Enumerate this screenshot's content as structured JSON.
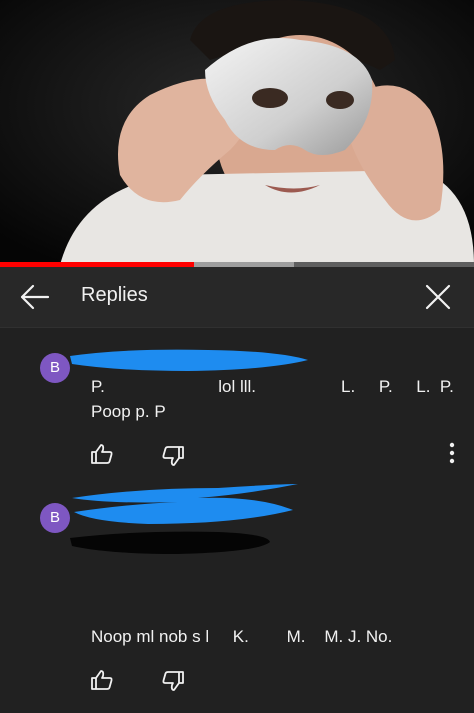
{
  "header": {
    "title": "Replies"
  },
  "video": {
    "progress_fraction": 0.41,
    "buffered_fraction": 0.62
  },
  "comments": [
    {
      "avatar_letter": "B",
      "text_line_1": "P.                        lol lll.                  L.     P.     L.  P.",
      "text_line_2": "Poop p. P"
    },
    {
      "avatar_letter": "B",
      "text_line_1": "Noop ml nob s l     K.        M.    M. J. No."
    }
  ],
  "colors": {
    "background": "#212121",
    "header_bg": "#282828",
    "avatar": "#7e57c2",
    "redaction_blue": "#1e8cf0",
    "progress_red": "#ff0000"
  },
  "icons": [
    "back-arrow-icon",
    "close-icon",
    "thumbs-up-icon",
    "thumbs-down-icon",
    "more-vert-icon"
  ]
}
